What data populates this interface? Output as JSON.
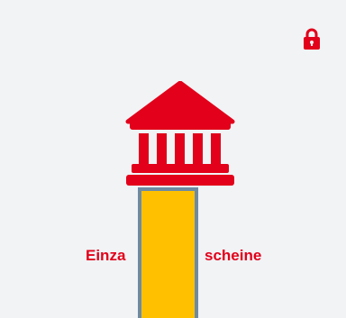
{
  "tile": {
    "label_left": "Einza",
    "label_right": "scheine",
    "icon": "bank-icon",
    "status_icon": "lock-icon"
  },
  "colors": {
    "background": "#f1f3f5",
    "accent": "#e2001a",
    "overlay_fill": "#ffc000",
    "overlay_border": "#6e8aa3"
  }
}
